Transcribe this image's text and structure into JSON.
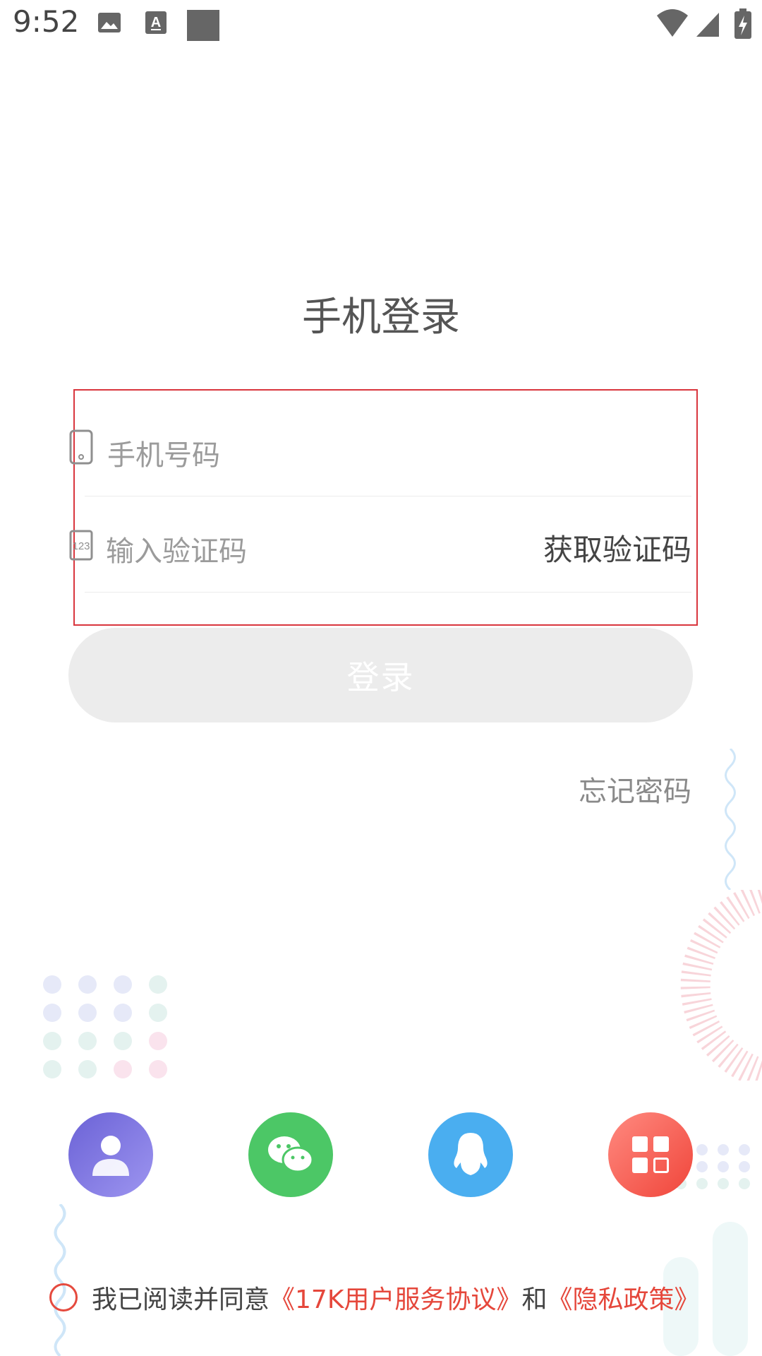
{
  "status_bar": {
    "time": "9:52",
    "icons": [
      "image-icon",
      "text-icon",
      "square-icon",
      "wifi-icon",
      "signal-icon",
      "battery-icon"
    ]
  },
  "login": {
    "title": "手机登录",
    "phone_placeholder": "手机号码",
    "code_placeholder": "输入验证码",
    "get_code_label": "获取验证码",
    "login_button_label": "登录",
    "forgot_password_label": "忘记密码"
  },
  "social": {
    "icons": [
      "account-icon",
      "wechat-icon",
      "qq-icon",
      "more-apps-icon"
    ],
    "colors": {
      "account": "#7b72e0",
      "wechat": "#4cc766",
      "qq": "#4aaef0",
      "more": "#f0453a"
    }
  },
  "agreement": {
    "prefix": "我已阅读并同意",
    "terms_link": "《17K用户服务协议》",
    "and": "和",
    "privacy_link": "《隐私政策》"
  },
  "theme": {
    "accent_red": "#e5473b",
    "highlight_border": "#d9363e"
  }
}
